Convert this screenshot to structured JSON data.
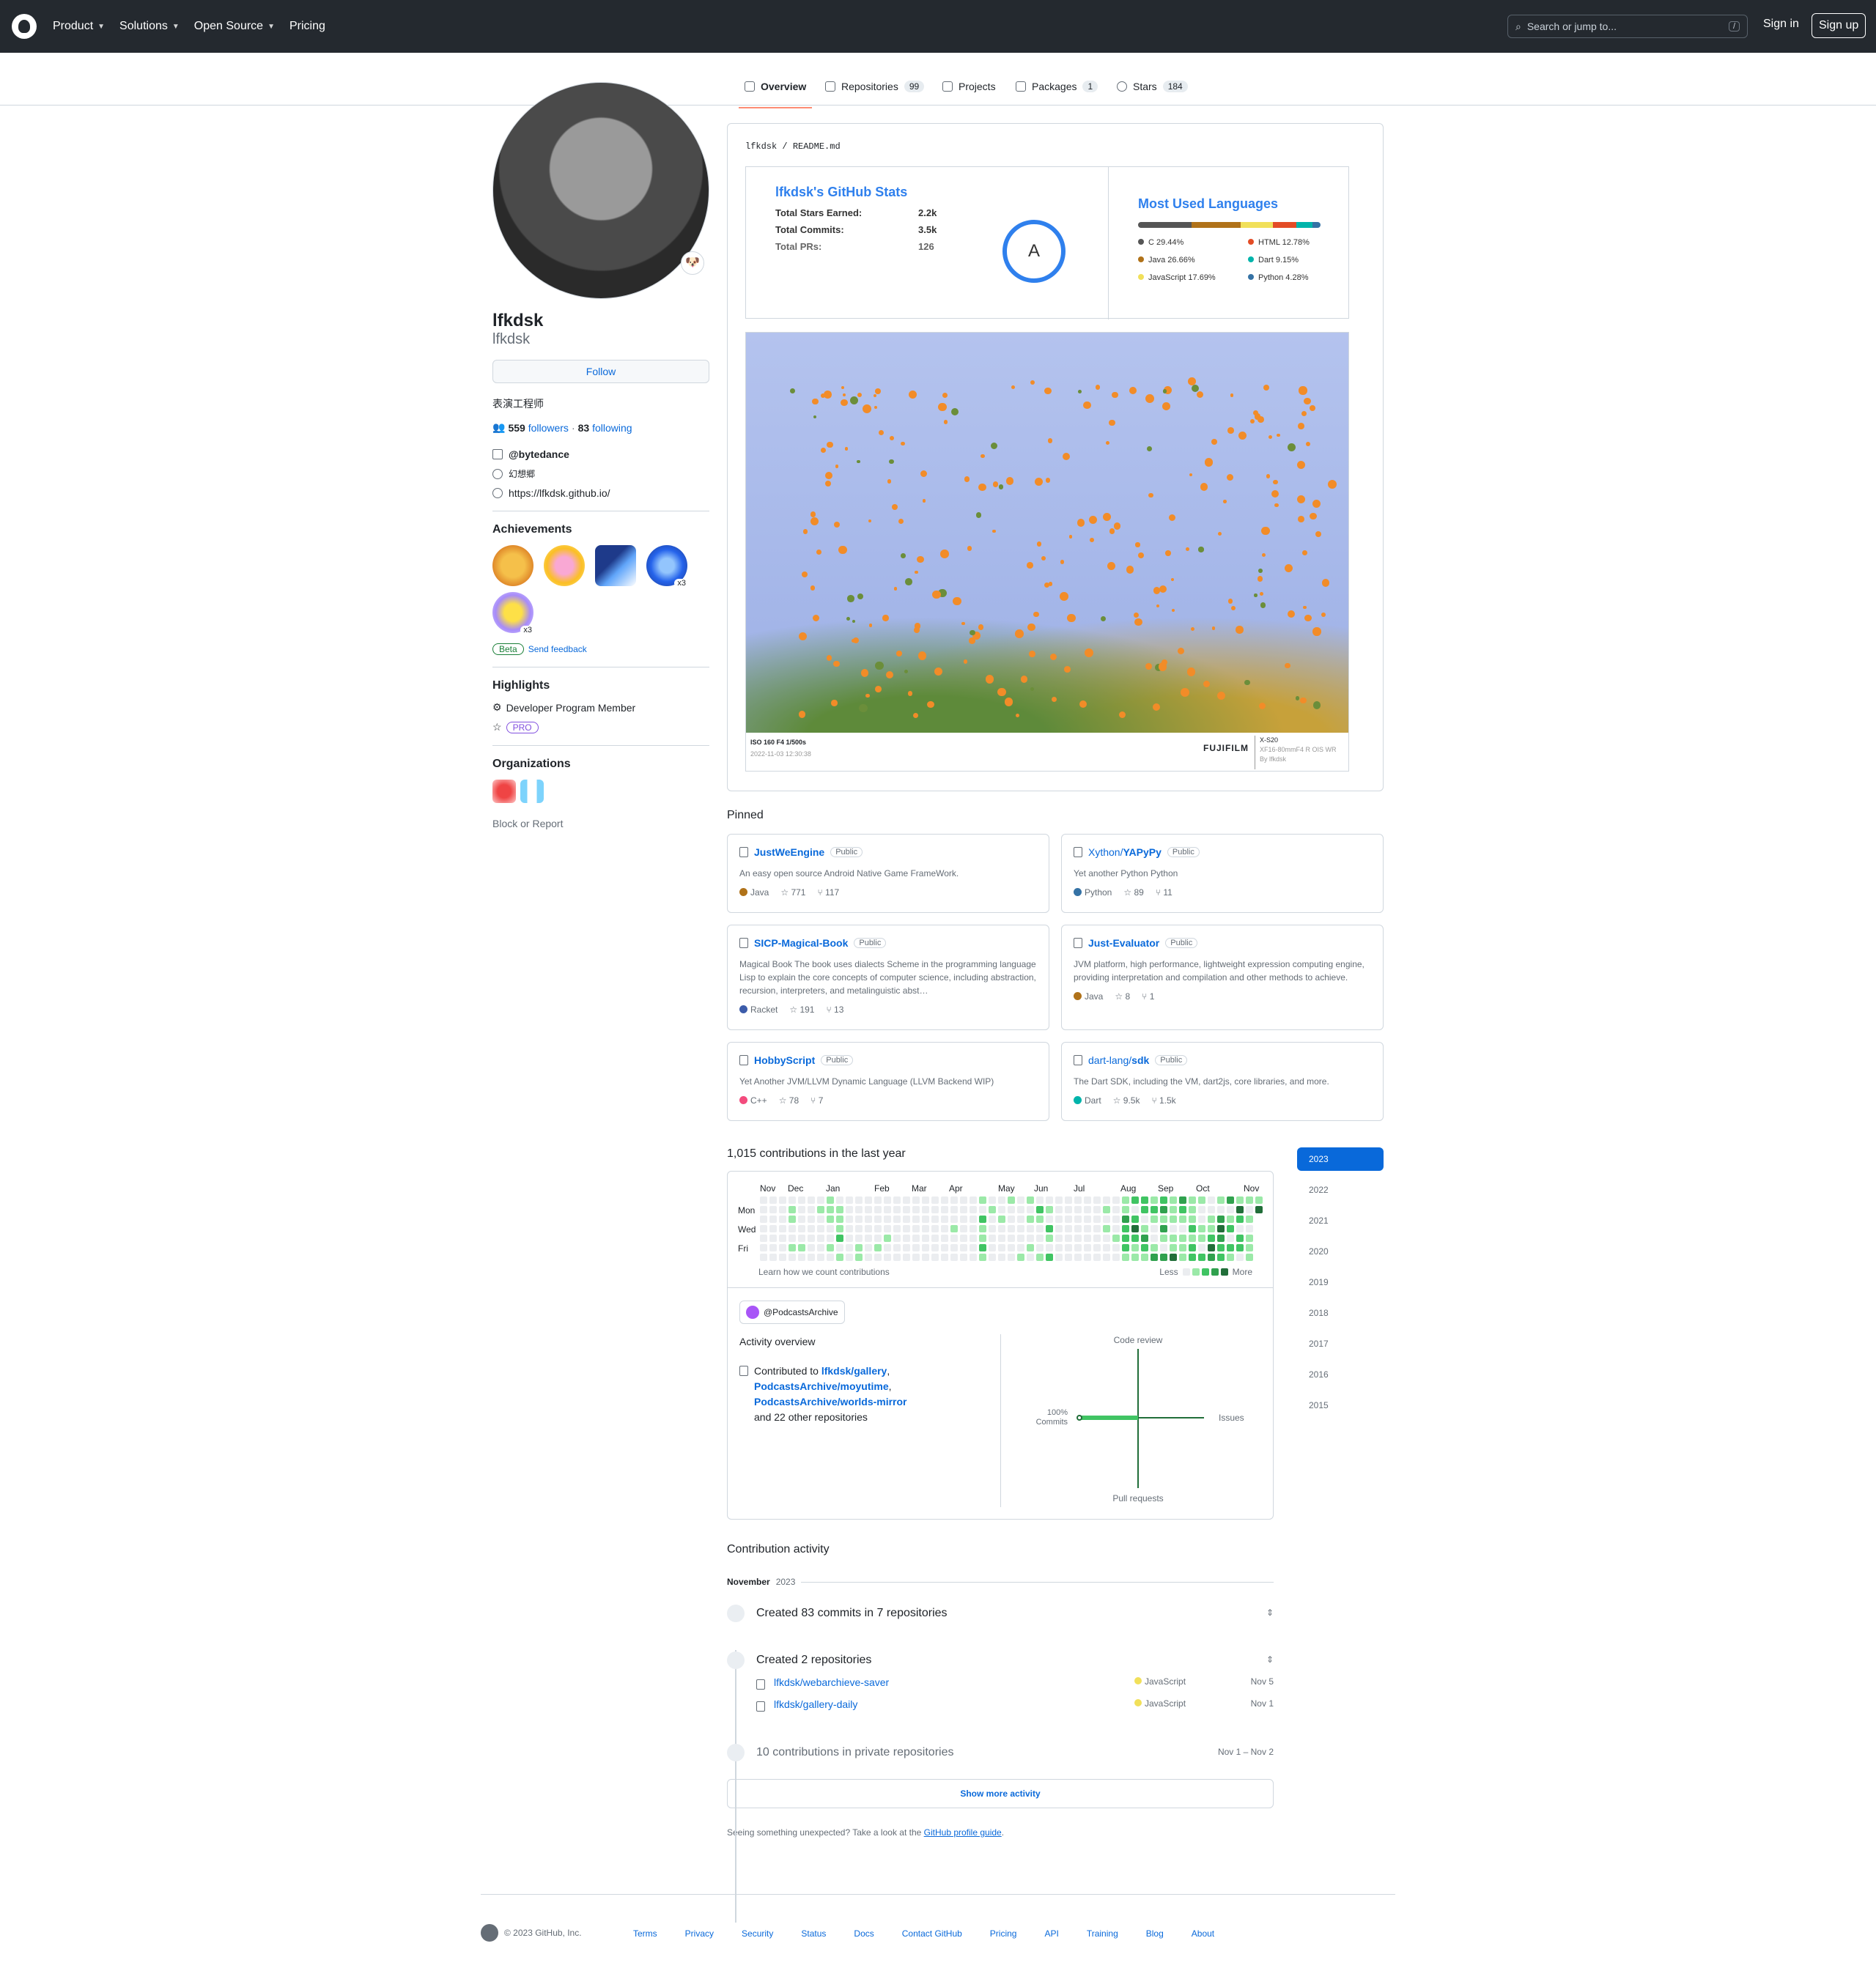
{
  "header": {
    "nav": [
      "Product",
      "Solutions",
      "Open Source",
      "Pricing"
    ],
    "search_placeholder": "Search or jump to...",
    "search_key": "/",
    "signin": "Sign in",
    "signup": "Sign up"
  },
  "tabs": [
    {
      "label": "Overview",
      "count": ""
    },
    {
      "label": "Repositories",
      "count": "99"
    },
    {
      "label": "Projects",
      "count": ""
    },
    {
      "label": "Packages",
      "count": "1"
    },
    {
      "label": "Stars",
      "count": "184"
    }
  ],
  "profile": {
    "name": "lfkdsk",
    "login": "lfkdsk",
    "follow": "Follow",
    "bio": "表演工程师",
    "followers": "559",
    "followers_label": "followers",
    "following": "83",
    "following_label": "following",
    "separator": "·",
    "company": "@bytedance",
    "location": "幻想郷",
    "website": "https://lfkdsk.github.io/",
    "status_emoji": "🐶"
  },
  "achievements": {
    "title": "Achievements",
    "badges": [
      {
        "name": "starstruck",
        "count": ""
      },
      {
        "name": "yolo",
        "count": ""
      },
      {
        "name": "pull-shark-alt",
        "count": ""
      },
      {
        "name": "pull-shark",
        "count": "x3"
      },
      {
        "name": "quickdraw",
        "count": "x3"
      }
    ],
    "beta": "Beta",
    "feedback": "Send feedback"
  },
  "highlights": {
    "title": "Highlights",
    "member": "Developer Program Member",
    "pro": "PRO"
  },
  "organizations": {
    "title": "Organizations",
    "block": "Block or Report"
  },
  "readme": {
    "owner": "lfkdsk",
    "sep": "/",
    "file": "README.md"
  },
  "stats": {
    "title": "lfkdsk's GitHub Stats",
    "rows": [
      {
        "label": "Total Stars Earned:",
        "value": "2.2k"
      },
      {
        "label": "Total Commits:",
        "value": "3.5k"
      },
      {
        "label": "Total PRs:",
        "value": "126"
      }
    ],
    "grade": "A"
  },
  "languages": {
    "title": "Most Used Languages",
    "items": [
      {
        "name": "C 29.44%",
        "color": "#555555",
        "pct": 29.44
      },
      {
        "name": "Java 26.66%",
        "color": "#b07219",
        "pct": 26.66
      },
      {
        "name": "JavaScript 17.69%",
        "color": "#f1e05a",
        "pct": 17.69
      },
      {
        "name": "HTML 12.78%",
        "color": "#e34c26",
        "pct": 12.78
      },
      {
        "name": "Dart 9.15%",
        "color": "#00B4AB",
        "pct": 9.15
      },
      {
        "name": "Python 4.28%",
        "color": "#3572A5",
        "pct": 4.28
      }
    ]
  },
  "photo": {
    "exif": "ISO 160 F4 1/500s",
    "date": "2022-11-03 12:30:38",
    "brand": "FUJIFILM",
    "model": "X-S20",
    "lens": "XF16-80mmF4 R OIS WR",
    "by": "By lfkdsk"
  },
  "pinned": {
    "title": "Pinned",
    "items": [
      {
        "owner": "",
        "name": "JustWeEngine",
        "vis": "Public",
        "desc": "An easy open source Android Native Game FrameWork.",
        "lang": "Java",
        "lang_color": "#b07219",
        "stars": "771",
        "forks": "117"
      },
      {
        "owner": "Xython/",
        "name": "YAPyPy",
        "vis": "Public",
        "desc": "Yet another Python Python",
        "lang": "Python",
        "lang_color": "#3572A5",
        "stars": "89",
        "forks": "11"
      },
      {
        "owner": "",
        "name": "SICP-Magical-Book",
        "vis": "Public",
        "desc": "Magical Book The book uses dialects Scheme in the programming language Lisp to explain the core concepts of computer science, including abstraction, recursion, interpreters, and metalinguistic abst…",
        "lang": "Racket",
        "lang_color": "#3c5caa",
        "stars": "191",
        "forks": "13"
      },
      {
        "owner": "",
        "name": "Just-Evaluator",
        "vis": "Public",
        "desc": "JVM platform, high performance, lightweight expression computing engine, providing interpretation and compilation and other methods to achieve.",
        "lang": "Java",
        "lang_color": "#b07219",
        "stars": "8",
        "forks": "1"
      },
      {
        "owner": "",
        "name": "HobbyScript",
        "vis": "Public",
        "desc": "Yet Another JVM/LLVM Dynamic Language (LLVM Backend WIP)",
        "lang": "C++",
        "lang_color": "#f34b7d",
        "stars": "78",
        "forks": "7"
      },
      {
        "owner": "dart-lang/",
        "name": "sdk",
        "vis": "Public",
        "desc": "The Dart SDK, including the VM, dart2js, core libraries, and more.",
        "lang": "Dart",
        "lang_color": "#00B4AB",
        "stars": "9.5k",
        "forks": "1.5k"
      }
    ]
  },
  "contributions": {
    "title": "1,015 contributions in the last year",
    "months": [
      "Nov",
      "Dec",
      "Jan",
      "Feb",
      "Mar",
      "Apr",
      "May",
      "Jun",
      "Jul",
      "Aug",
      "Sep",
      "Oct",
      "Nov"
    ],
    "days": [
      "Mon",
      "Wed",
      "Fri"
    ],
    "learn": "Learn how we count contributions",
    "less": "Less",
    "more": "More",
    "levels": [
      "#ebedf0",
      "#9be9a8",
      "#40c463",
      "#30a14e",
      "#216e39"
    ]
  },
  "overview": {
    "org": "@PodcastsArchive",
    "title": "Activity overview",
    "prefix": "Contributed to",
    "repos": [
      "lfkdsk/gallery",
      "PodcastsArchive/moyutime",
      "PodcastsArchive/worlds-mirror"
    ],
    "others": "and 22 other repositories",
    "axes": {
      "top": "Code review",
      "right": "Issues",
      "bottom": "Pull requests",
      "left": "100%",
      "left2": "Commits"
    },
    "commits_pct": 100
  },
  "years": [
    "2023",
    "2022",
    "2021",
    "2020",
    "2019",
    "2018",
    "2017",
    "2016",
    "2015"
  ],
  "activity": {
    "title": "Contribution activity",
    "month": "November",
    "year": "2023",
    "commits": "Created 83 commits in 7 repositories",
    "created": "Created 2 repositories",
    "repos": [
      {
        "name": "lfkdsk/webarchieve-saver",
        "lang": "JavaScript",
        "date": "Nov 5"
      },
      {
        "name": "lfkdsk/gallery-daily",
        "lang": "JavaScript",
        "date": "Nov 1"
      }
    ],
    "private": "10 contributions in private repositories",
    "private_dates": "Nov 1 – Nov 2",
    "show_more": "Show more activity",
    "unexpected": "Seeing something unexpected? Take a look at the",
    "guide": "GitHub profile guide",
    "period": "."
  },
  "footer": {
    "copy": "© 2023 GitHub, Inc.",
    "links": [
      "Terms",
      "Privacy",
      "Security",
      "Status",
      "Docs",
      "Contact GitHub",
      "Pricing",
      "API",
      "Training",
      "Blog",
      "About"
    ]
  }
}
